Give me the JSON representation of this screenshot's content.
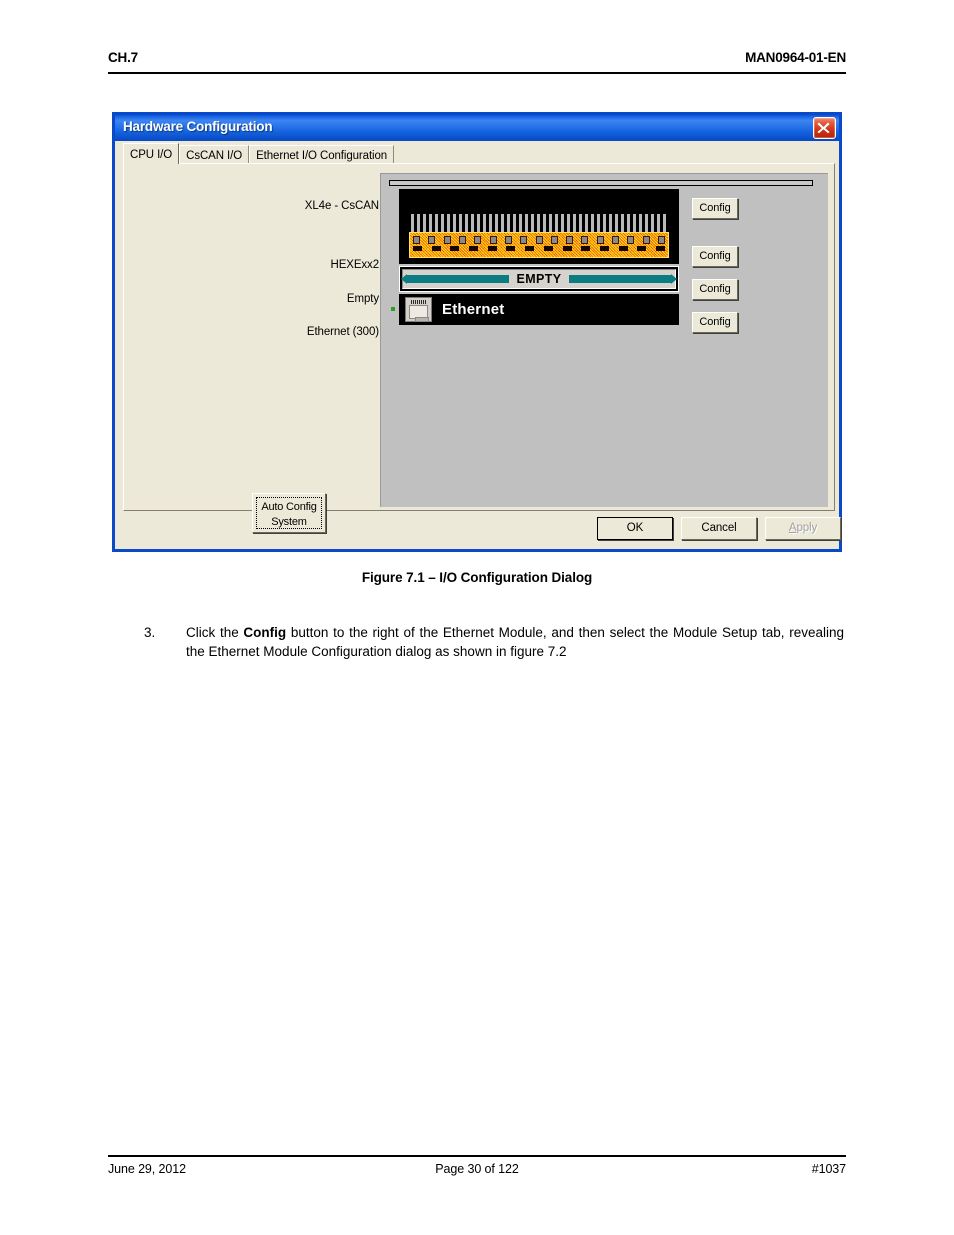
{
  "page": {
    "header_left": "CH.7",
    "header_right": "MAN0964-01-EN",
    "footer_left": "June 29, 2012",
    "footer_center": "Page 30 of 122",
    "footer_right": "#1037"
  },
  "dialog": {
    "title": "Hardware Configuration",
    "close_icon": "close-icon",
    "tabs": [
      {
        "label": "CPU I/O",
        "active": true
      },
      {
        "label": "CsCAN I/O",
        "active": false
      },
      {
        "label": "Ethernet I/O Configuration",
        "active": false
      }
    ],
    "slots": [
      {
        "label": "XL4e - CsCAN",
        "config_label": "Config"
      },
      {
        "label": "HEXExx2",
        "config_label": "Config"
      },
      {
        "label": "Empty",
        "config_label": "Config"
      },
      {
        "label": "Ethernet (300)",
        "config_label": "Config"
      }
    ],
    "module_graphic": {
      "empty_slot_text": "EMPTY",
      "ethernet_text": "Ethernet",
      "rj45_icon": "rj45-jack-icon",
      "led_color": "#2aa02a",
      "teal_color": "#0b7d82",
      "terminal_block_color": "#ff8c00"
    },
    "auto_config": {
      "line1": "Auto Config",
      "line2": "System"
    },
    "buttons": {
      "ok": "OK",
      "cancel": "Cancel",
      "apply_mnemonic": "A",
      "apply_rest": "pply",
      "apply_enabled": false
    },
    "colors": {
      "titlebar_blue": "#1e68e6",
      "window_frame": "#0a49c8",
      "face": "#ece9d8",
      "rack_grey": "#c0c0c0",
      "close_red": "#d0341a"
    }
  },
  "body": {
    "figure_caption": "Figure 7.1 – I/O Configuration Dialog",
    "step_number": "3.",
    "step_text_1": "Click the ",
    "step_text_bold": "Config",
    "step_text_2": " button to the right of the Ethernet Module, and then select the Module Setup tab, revealing the Ethernet Module Configuration dialog as shown in figure 7.2"
  }
}
